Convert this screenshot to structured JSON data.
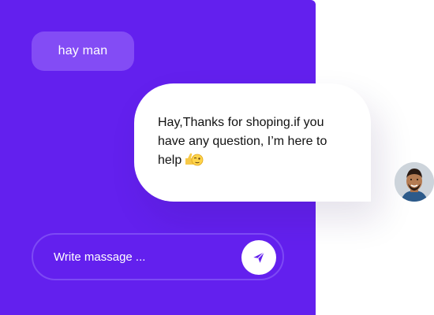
{
  "chat": {
    "user_message": "hay man",
    "bot_message": "Hay,Thanks for shoping.if you have any question, I’m here to help",
    "bot_emoji": "thumbs-up-winking-face",
    "avatar": "user-avatar-photo"
  },
  "composer": {
    "placeholder": "Write massage ...",
    "value": "",
    "send_icon": "paper-plane-icon"
  },
  "colors": {
    "panel": "#6320ee",
    "user_bubble": "#834cf5",
    "bot_bubble": "#ffffff",
    "send_icon": "#6320ee"
  }
}
